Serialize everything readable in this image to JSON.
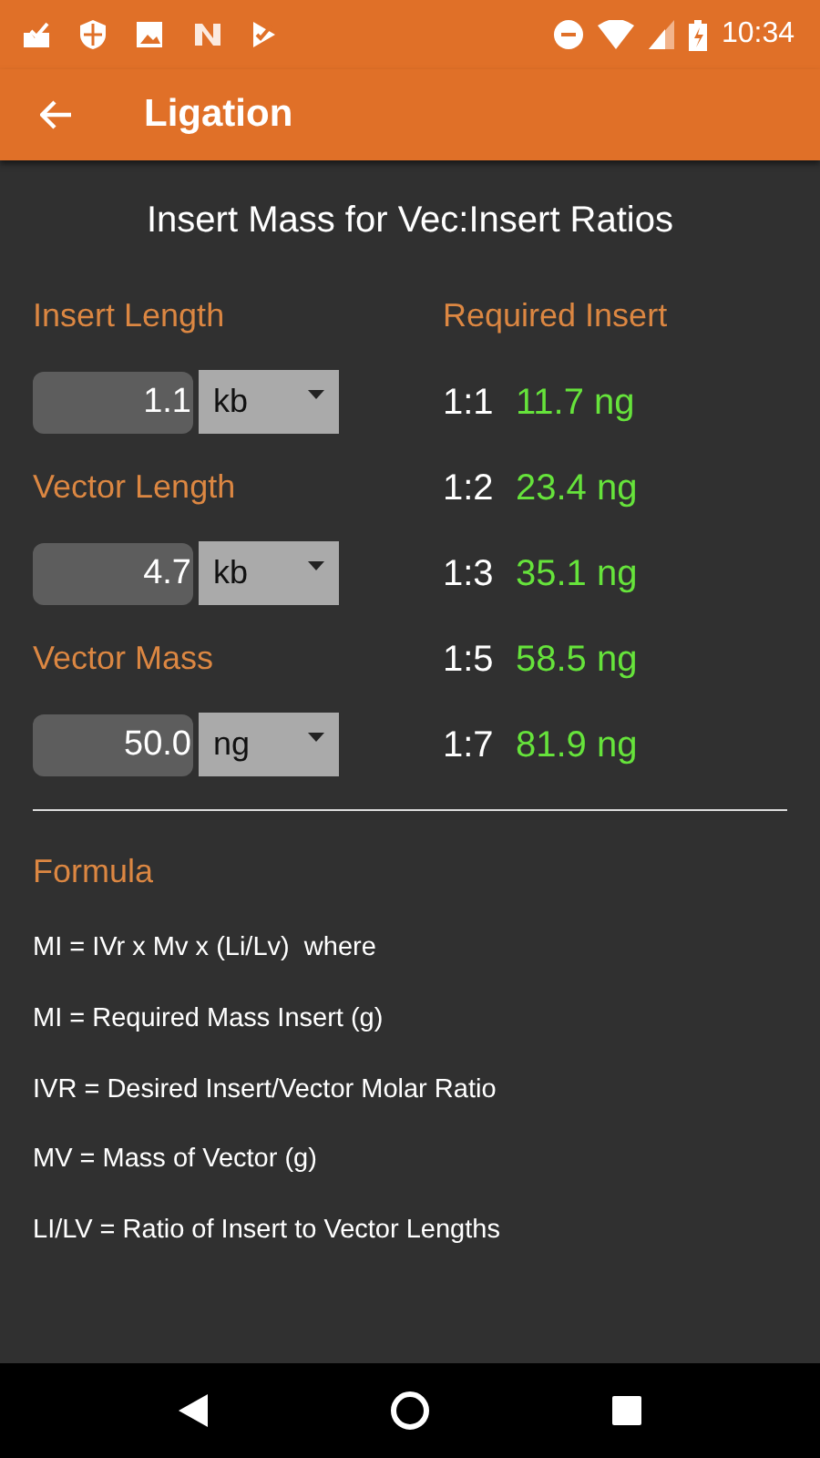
{
  "status_bar": {
    "time": "10:34"
  },
  "app_bar": {
    "title": "Ligation"
  },
  "heading": "Insert Mass for Vec:Insert Ratios",
  "inputs": [
    {
      "label": "Insert Length",
      "value": "1.1",
      "unit": "kb"
    },
    {
      "label": "Vector Length",
      "value": "4.7",
      "unit": "kb"
    },
    {
      "label": "Vector Mass",
      "value": "50.0",
      "unit": "ng"
    }
  ],
  "results": {
    "header": "Required Insert",
    "rows": [
      {
        "ratio": "1:1",
        "mass": "11.7 ng"
      },
      {
        "ratio": "1:2",
        "mass": "23.4 ng"
      },
      {
        "ratio": "1:3",
        "mass": "35.1 ng"
      },
      {
        "ratio": "1:5",
        "mass": "58.5 ng"
      },
      {
        "ratio": "1:7",
        "mass": "81.9 ng"
      }
    ]
  },
  "formula": {
    "title": "Formula",
    "lines": [
      "MI = IVr x Mv x (Li/Lv)  where",
      "MI = Required Mass Insert (g)",
      "IVR = Desired Insert/Vector Molar Ratio",
      "MV = Mass of Vector (g)",
      "LI/LV = Ratio of Insert to Vector Lengths"
    ]
  }
}
